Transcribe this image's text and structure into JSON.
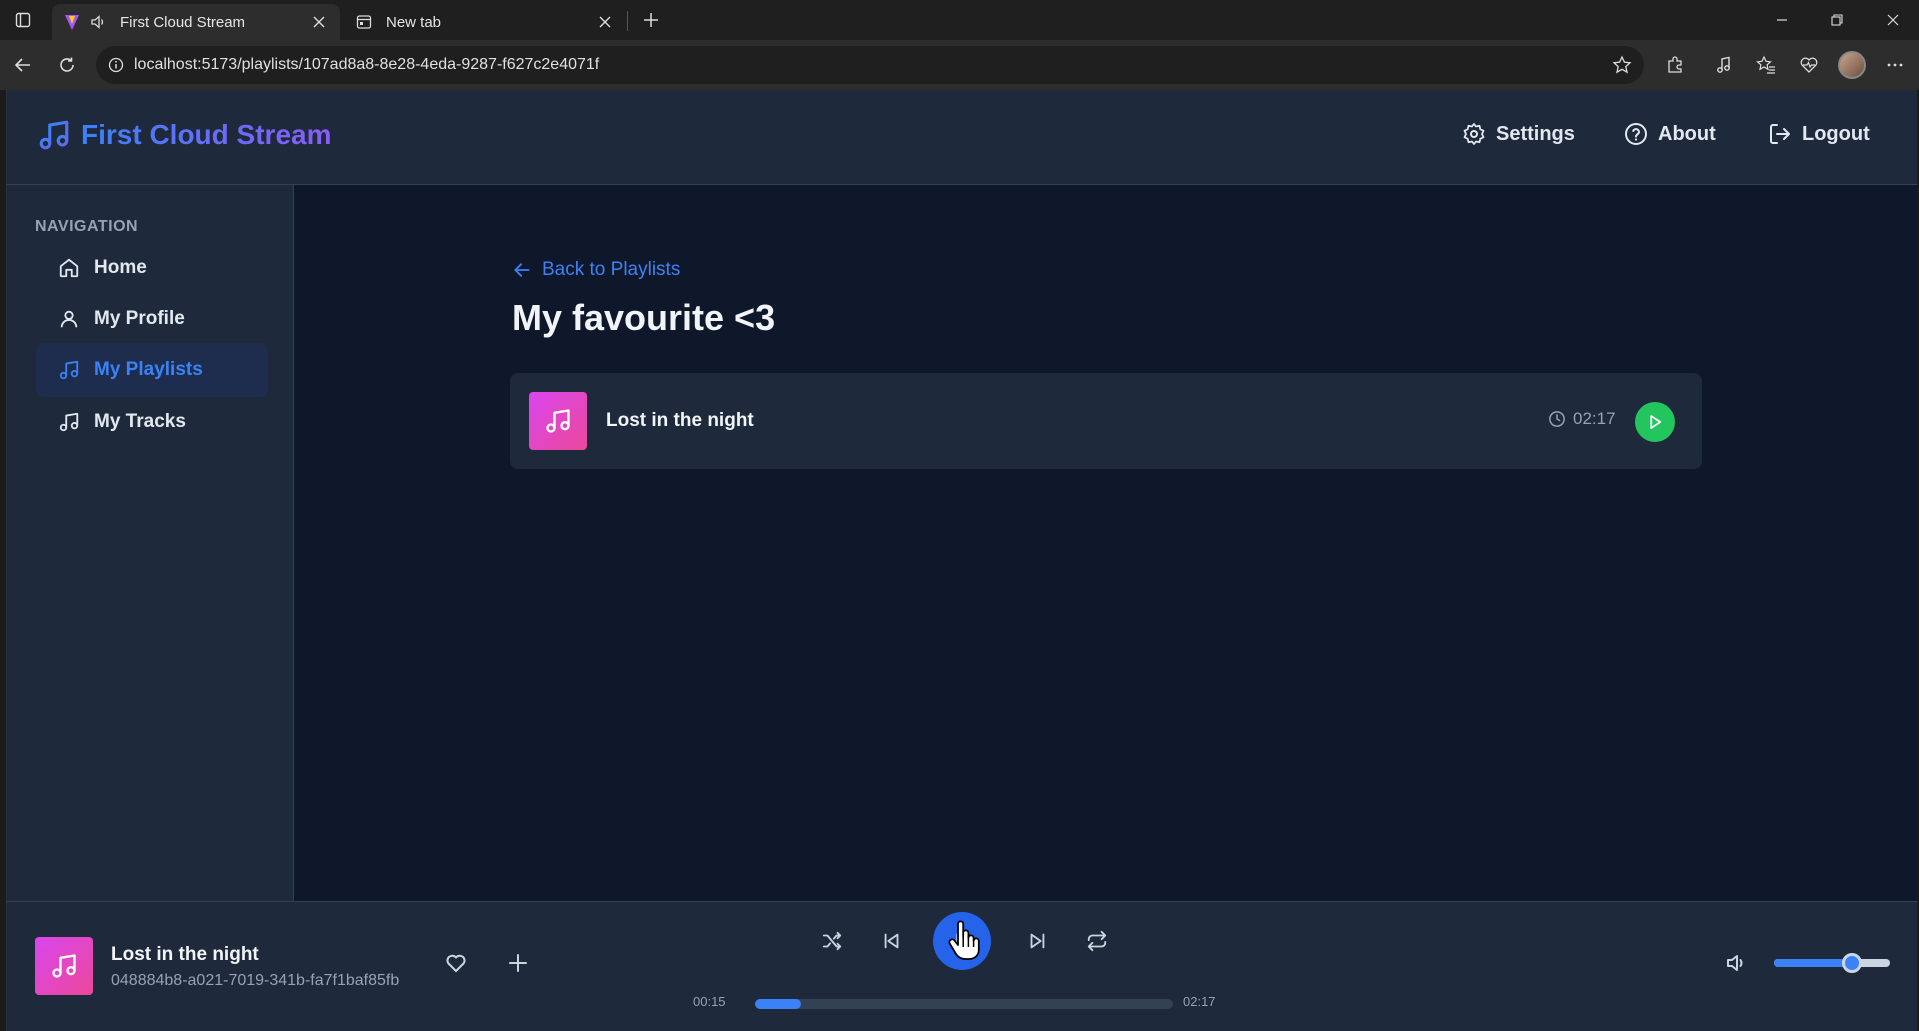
{
  "browser": {
    "tabs": [
      {
        "title": "First Cloud Stream",
        "active": true
      },
      {
        "title": "New tab",
        "active": false
      }
    ],
    "url": "localhost:5173/playlists/107ad8a8-8e28-4eda-9287-f627c2e4071f"
  },
  "app": {
    "brand": "First Cloud Stream",
    "header_links": {
      "settings": "Settings",
      "about": "About",
      "logout": "Logout"
    },
    "sidebar": {
      "heading": "NAVIGATION",
      "items": [
        {
          "label": "Home",
          "icon": "home-icon",
          "active": false
        },
        {
          "label": "My Profile",
          "icon": "user-icon",
          "active": false
        },
        {
          "label": "My Playlists",
          "icon": "music-note-icon",
          "active": true
        },
        {
          "label": "My Tracks",
          "icon": "music-note-icon",
          "active": false
        }
      ]
    },
    "main": {
      "back_label": "Back to Playlists",
      "playlist_title": "My favourite <3",
      "tracks": [
        {
          "title": "Lost in the night",
          "duration": "02:17"
        }
      ]
    },
    "player": {
      "title": "Lost in the night",
      "subtitle": "048884b8-a021-7019-341b-fa7f1baf85fb",
      "elapsed": "00:15",
      "total": "02:17",
      "progress_fraction": 0.109,
      "volume_fraction": 0.67
    }
  },
  "colors": {
    "accent": "#3b82f6",
    "play_green": "#22c55e",
    "art_gradient_start": "#d946ef",
    "art_gradient_end": "#ec4899"
  }
}
